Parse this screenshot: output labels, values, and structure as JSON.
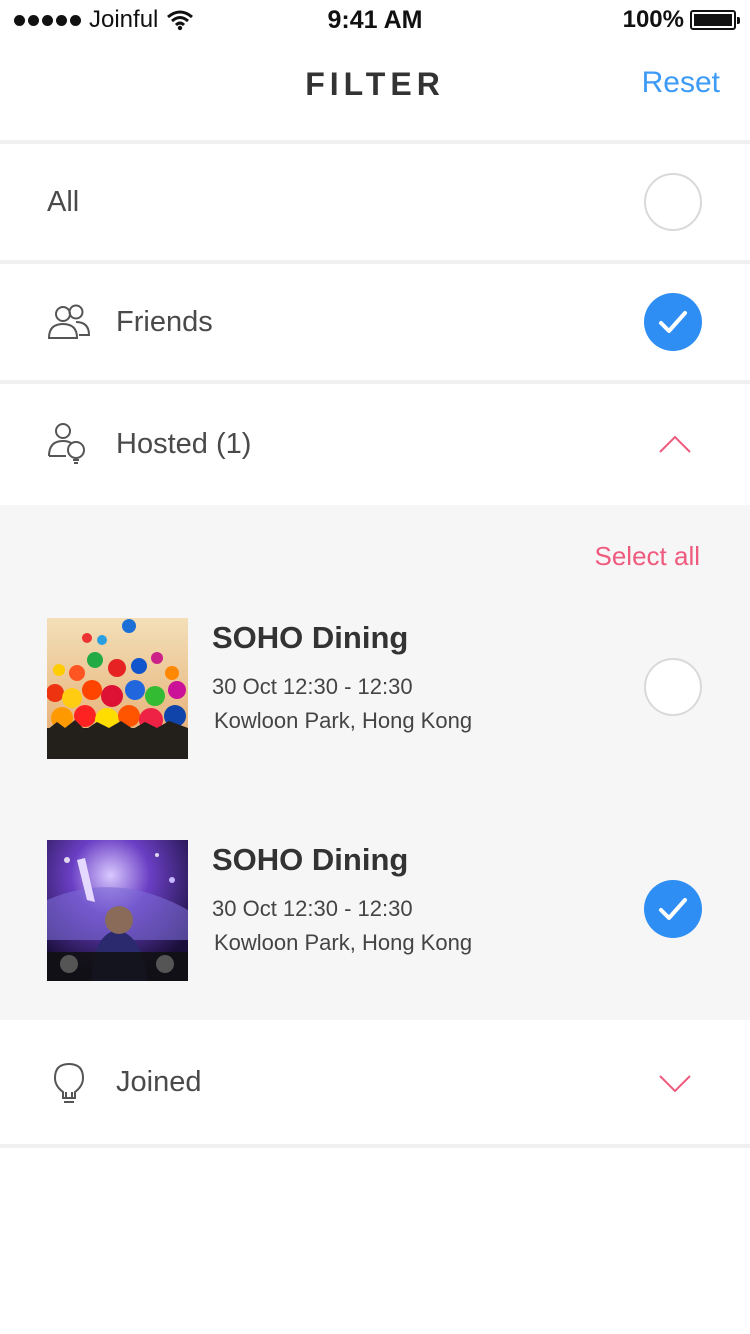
{
  "status_bar": {
    "carrier": "Joinful",
    "time": "9:41 AM",
    "battery": "100%",
    "signal_icon": "signal-dots-icon",
    "wifi_icon": "wifi-icon",
    "battery_icon": "battery-icon"
  },
  "header": {
    "title": "FILTER",
    "reset_label": "Reset"
  },
  "filters": {
    "all": {
      "label": "All",
      "checked": false
    },
    "friends": {
      "label": "Friends",
      "icon": "friends-icon",
      "checked": true
    },
    "hosted": {
      "label": "Hosted (1)",
      "icon": "host-icon",
      "expanded": true,
      "chevron": "chevron-up-icon"
    },
    "joined": {
      "label": "Joined",
      "icon": "lightbulb-icon",
      "expanded": false,
      "chevron": "chevron-down-icon"
    }
  },
  "hosted_list": {
    "select_all_label": "Select all",
    "events": [
      {
        "title": "SOHO Dining",
        "time": "30 Oct 12:30 - 12:30",
        "location": "Kowloon Park, Hong Kong",
        "image": "balloons-photo",
        "checked": false
      },
      {
        "title": "SOHO Dining",
        "time": "30 Oct 12:30 - 12:30",
        "location": "Kowloon Park, Hong Kong",
        "image": "dj-concert-photo",
        "checked": true
      }
    ]
  },
  "colors": {
    "accent_blue": "#2f8ef3",
    "reset_blue": "#3d9bf5",
    "accent_pink": "#ef5b7e",
    "divider": "#f0f0f0",
    "expanded_bg": "#f6f6f6"
  }
}
